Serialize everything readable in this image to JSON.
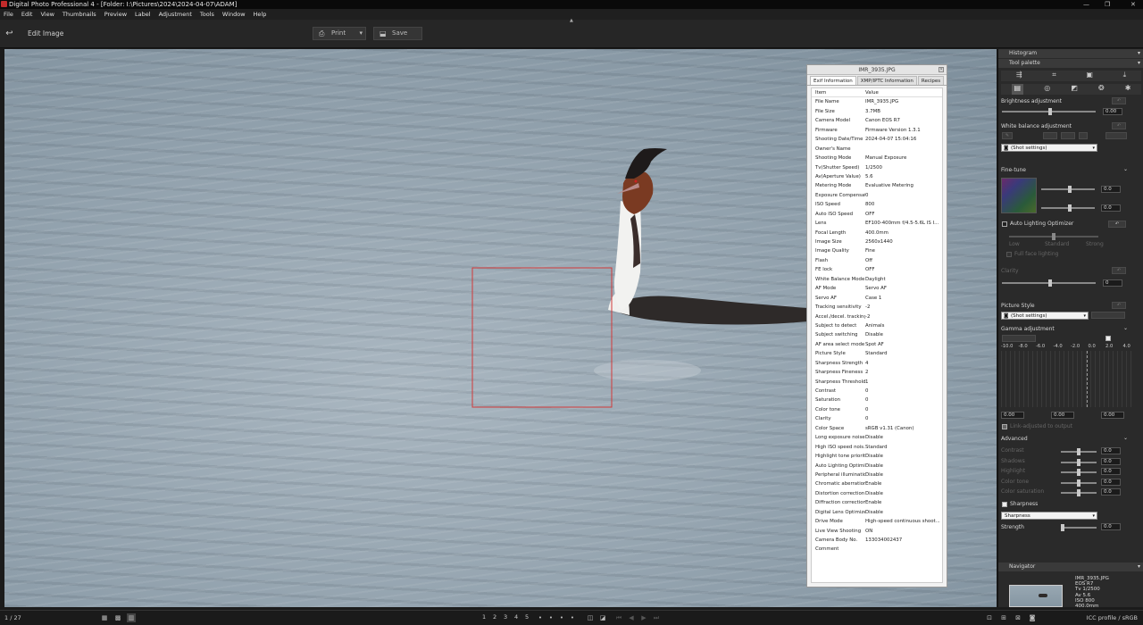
{
  "window": {
    "title": "Digital Photo Professional 4 - [Folder: I:\\Pictures\\2024\\2024-04-07\\ADAM]"
  },
  "menu": [
    "File",
    "Edit",
    "View",
    "Thumbnails",
    "Preview",
    "Label",
    "Adjustment",
    "Tools",
    "Window",
    "Help"
  ],
  "toolbar": {
    "mode_label": "Edit Image",
    "print_label": "Print",
    "save_label": "Save"
  },
  "exif": {
    "window_title": "IMR_3935.JPG",
    "tabs": [
      "Exif Information",
      "XMP/IPTC Information",
      "Recipes"
    ],
    "header": {
      "item": "Item",
      "value": "Value"
    },
    "rows": [
      [
        "File Name",
        "IMR_3935.JPG"
      ],
      [
        "File Size",
        "3.7MB"
      ],
      [
        "Camera Model",
        "Canon EOS R7"
      ],
      [
        "Firmware",
        "Firmware Version 1.3.1"
      ],
      [
        "Shooting Date/Time",
        "2024-04-07 15:04:16"
      ],
      [
        "Owner's Name",
        ""
      ],
      [
        "Shooting Mode",
        "Manual Exposure"
      ],
      [
        "Tv(Shutter Speed)",
        "1/2500"
      ],
      [
        "Av(Aperture Value)",
        "5.6"
      ],
      [
        "Metering Mode",
        "Evaluative Metering"
      ],
      [
        "Exposure Compensati...",
        "0"
      ],
      [
        "ISO Speed",
        "800"
      ],
      [
        "Auto ISO Speed",
        "OFF"
      ],
      [
        "Lens",
        "EF100-400mm f/4.5-5.6L IS I..."
      ],
      [
        "Focal Length",
        "400.0mm"
      ],
      [
        "Image Size",
        "2560x1440"
      ],
      [
        "Image Quality",
        "Fine"
      ],
      [
        "Flash",
        "Off"
      ],
      [
        "FE lock",
        "OFF"
      ],
      [
        "White Balance Mode",
        "Daylight"
      ],
      [
        "AF Mode",
        "Servo AF"
      ],
      [
        "Servo AF",
        "Case 1"
      ],
      [
        "Tracking sensitivity",
        "-2"
      ],
      [
        "Accel./decel. tracking",
        "-2"
      ],
      [
        "Subject to detect",
        "Animals"
      ],
      [
        "Subject switching",
        "Disable"
      ],
      [
        "AF area select mode",
        "Spot AF"
      ],
      [
        "Picture Style",
        "Standard"
      ],
      [
        "Sharpness Strength",
        "4"
      ],
      [
        "Sharpness Fineness",
        "2"
      ],
      [
        "Sharpness Threshold",
        "1"
      ],
      [
        "Contrast",
        "0"
      ],
      [
        "Saturation",
        "0"
      ],
      [
        "Color tone",
        "0"
      ],
      [
        "Clarity",
        "0"
      ],
      [
        "Color Space",
        "sRGB v1.31 (Canon)"
      ],
      [
        "Long exposure noise ...",
        "Disable"
      ],
      [
        "High ISO speed nois...",
        "Standard"
      ],
      [
        "Highlight tone priority",
        "Disable"
      ],
      [
        "Auto Lighting Optimizer",
        "Disable"
      ],
      [
        "Peripheral illuminatio...",
        "Disable"
      ],
      [
        "Chromatic aberration ...",
        "Enable"
      ],
      [
        "Distortion correction",
        "Disable"
      ],
      [
        "Diffraction correction",
        "Enable"
      ],
      [
        "Digital Lens Optimizer",
        "Disable"
      ],
      [
        "Drive Mode",
        "High-speed continuous shoot..."
      ],
      [
        "Live View Shooting",
        "ON"
      ],
      [
        "Camera Body No.",
        "133034002437"
      ],
      [
        "Comment",
        ""
      ]
    ]
  },
  "tool": {
    "histogram": "Histogram",
    "palette": "Tool palette",
    "brightness": "Brightness adjustment",
    "brightness_val": "0.00",
    "wb": "White balance adjustment",
    "shot_settings": "(Shot settings)",
    "finetune": "Fine-tune",
    "ft_val1": "0.0",
    "ft_val2": "0.0",
    "alo": "Auto Lighting Optimizer",
    "alo_low": "Low",
    "alo_std": "Standard",
    "alo_strong": "Strong",
    "alo_face": "Full face lighting",
    "clarity": "Clarity",
    "clarity_val": "0",
    "picstyle": "Picture Style",
    "picstyle_val": "(Shot settings)",
    "gamma": "Gamma adjustment",
    "gamma_axis": [
      "-10.0",
      "-8.0",
      "-6.0",
      "-4.0",
      "-2.0",
      "0.0",
      "2.0",
      "4.0"
    ],
    "gamma_vals": [
      "0.00",
      "0.00",
      "0.00"
    ],
    "gamma_link": "Link-adjusted to output",
    "advanced": "Advanced",
    "adv_items": [
      "Contrast",
      "Shadows",
      "Highlight",
      "Color tone",
      "Color saturation"
    ],
    "adv_vals": [
      "0.0",
      "0.0",
      "0.0",
      "0.0",
      "0.0"
    ],
    "sharpness": "Sharpness",
    "sharp_mode": "Sharpness",
    "strength": "Strength",
    "strength_val": "0.0",
    "navigator": "Navigator",
    "nav_info": [
      "IMR_3935.JPG",
      "EOS R7",
      "Tv 1/2500",
      "Av 5.6",
      "ISO 800",
      "400.0mm"
    ]
  },
  "status": {
    "count": "1 / 27",
    "icc": "ICC profile / sRGB",
    "zoom_levels": [
      "1",
      "2",
      "3",
      "4",
      "5"
    ]
  },
  "colors": {
    "focus_frame": "#d23a3a",
    "accent_bg": "#2a2a2a"
  }
}
